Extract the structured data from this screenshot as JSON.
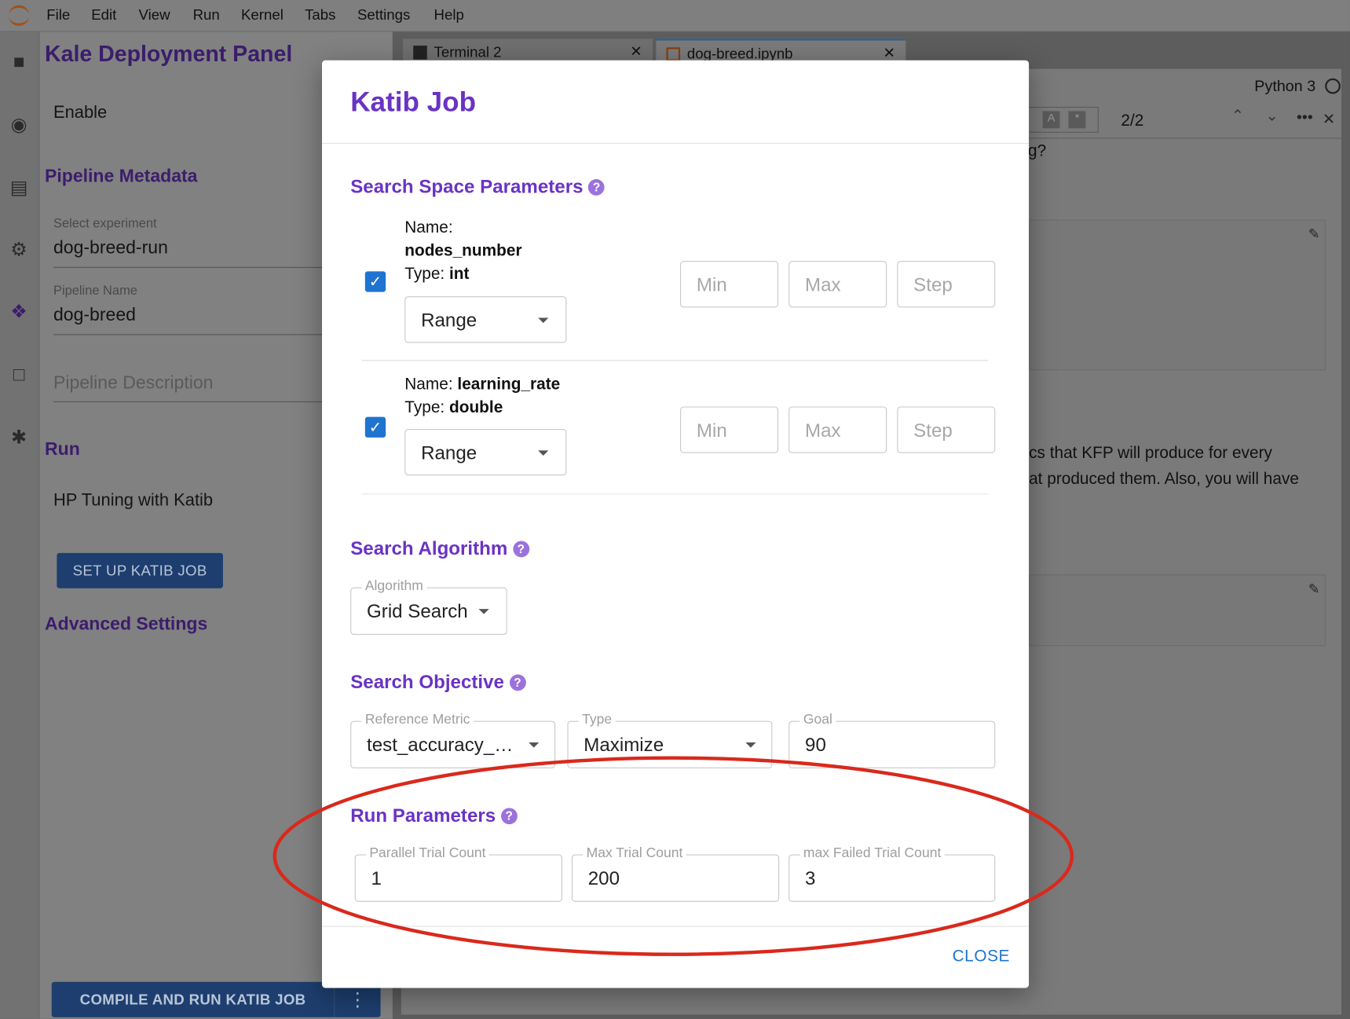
{
  "menu": [
    "File",
    "Edit",
    "View",
    "Run",
    "Kernel",
    "Tabs",
    "Settings",
    "Help"
  ],
  "sidebar_icons": [
    "folder-icon",
    "stop-circle-icon",
    "commands-icon",
    "gears-icon",
    "kale-icon",
    "window-icon",
    "puzzle-icon"
  ],
  "kale_panel": {
    "title": "Kale Deployment Panel",
    "enable_label": "Enable",
    "pipeline_metadata": "Pipeline Metadata",
    "experiment_label": "Select experiment",
    "experiment_value": "dog-breed-run",
    "pipeline_name_label": "Pipeline Name",
    "pipeline_name_value": "dog-breed",
    "pipeline_description_placeholder": "Pipeline Description",
    "run_heading": "Run",
    "hp_tuning_label": "HP Tuning with Katib",
    "setup_button": "SET UP KATIB JOB",
    "advanced_settings": "Advanced Settings",
    "compile_button": "COMPILE AND RUN KATIB JOB"
  },
  "tabs": [
    {
      "label": "Terminal 2"
    },
    {
      "label": "dog-breed.ipynb",
      "active": true
    }
  ],
  "notebook": {
    "kernel": "Python 3",
    "search_count": "2/2",
    "text_fragment": "g?",
    "text_line1": "cs that KFP will produce for every",
    "text_line2": "at produced them. Also, you will have"
  },
  "modal": {
    "title": "Katib Job",
    "search_space": {
      "heading": "Search Space Parameters",
      "params": [
        {
          "name_label": "Name:",
          "name": "nodes_number",
          "type_label": "Type:",
          "type": "int",
          "checked": true,
          "mode": "Range",
          "min_placeholder": "Min",
          "max_placeholder": "Max",
          "step_placeholder": "Step"
        },
        {
          "name_label": "Name:",
          "name": "learning_rate",
          "type_label": "Type:",
          "type": "double",
          "checked": true,
          "mode": "Range",
          "min_placeholder": "Min",
          "max_placeholder": "Max",
          "step_placeholder": "Step"
        }
      ]
    },
    "algorithm": {
      "heading": "Search Algorithm",
      "label": "Algorithm",
      "value": "Grid Search"
    },
    "objective": {
      "heading": "Search Objective",
      "metric_label": "Reference Metric",
      "metric_value": "test_accuracy_…",
      "type_label": "Type",
      "type_value": "Maximize",
      "goal_label": "Goal",
      "goal_value": "90"
    },
    "run_parameters": {
      "heading": "Run Parameters",
      "parallel_label": "Parallel Trial Count",
      "parallel_value": "1",
      "max_label": "Max Trial Count",
      "max_value": "200",
      "failed_label": "max Failed Trial Count",
      "failed_value": "3"
    },
    "close_button": "CLOSE"
  },
  "colors": {
    "accent": "#6a33c4",
    "checkbox": "#1e74d0",
    "annotation": "#d9291c"
  }
}
